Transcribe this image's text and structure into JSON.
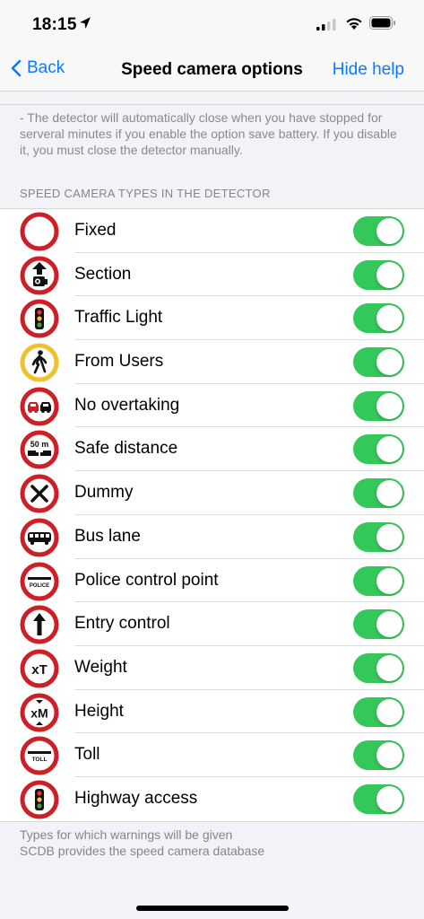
{
  "status_bar": {
    "time": "18:15"
  },
  "nav": {
    "back_label": "Back",
    "title": "Speed camera options",
    "hide_help_label": "Hide help"
  },
  "help_text": "- The detector will automatically close when you have stopped for serveral minutes if you enable the option save battery. If you disable it, you must close the detector manually.",
  "section_header": "SPEED CAMERA TYPES IN THE DETECTOR",
  "camera_types": [
    {
      "label": "Fixed",
      "icon": "fixed-camera-icon",
      "enabled": true
    },
    {
      "label": "Section",
      "icon": "section-camera-icon",
      "enabled": true
    },
    {
      "label": "Traffic Light",
      "icon": "traffic-light-icon",
      "enabled": true
    },
    {
      "label": "From Users",
      "icon": "pedestrian-icon",
      "enabled": true
    },
    {
      "label": "No overtaking",
      "icon": "no-overtaking-icon",
      "enabled": true
    },
    {
      "label": "Safe distance",
      "icon": "safe-distance-icon",
      "icon_text": "50 m",
      "enabled": true
    },
    {
      "label": "Dummy",
      "icon": "dummy-x-icon",
      "enabled": true
    },
    {
      "label": "Bus lane",
      "icon": "bus-icon",
      "enabled": true
    },
    {
      "label": "Police control point",
      "icon": "police-icon",
      "icon_text": "POLICE",
      "enabled": true
    },
    {
      "label": "Entry control",
      "icon": "up-arrow-icon",
      "enabled": true
    },
    {
      "label": "Weight",
      "icon": "weight-icon",
      "icon_text": "xT",
      "enabled": true
    },
    {
      "label": "Height",
      "icon": "height-icon",
      "icon_text": "xM",
      "enabled": true
    },
    {
      "label": "Toll",
      "icon": "toll-icon",
      "icon_text": "TOLL",
      "enabled": true
    },
    {
      "label": "Highway access",
      "icon": "highway-traffic-light-icon",
      "enabled": true
    }
  ],
  "footer": {
    "line1": "Types for which warnings will be given",
    "line2": "SCDB provides the speed camera database"
  },
  "colors": {
    "accent": "#0a7aff",
    "toggle_on": "#34c759",
    "sign_red": "#cc1f26",
    "sign_yellow": "#f2c12e"
  }
}
